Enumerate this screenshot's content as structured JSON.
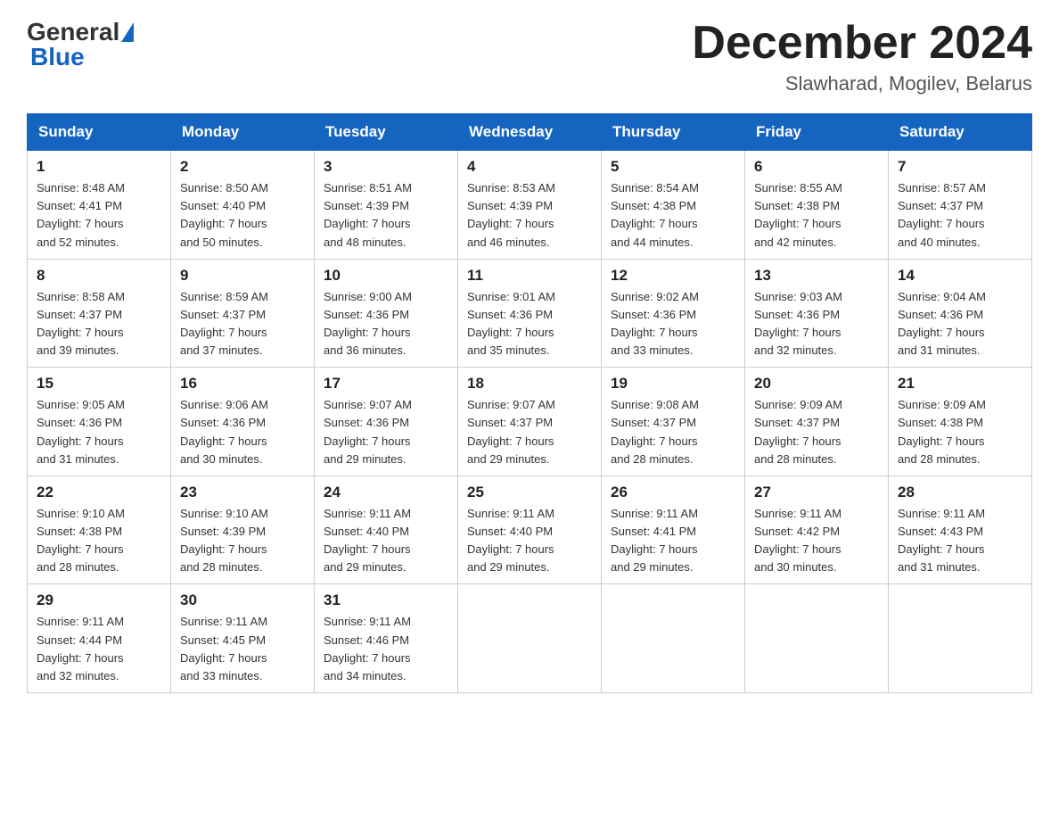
{
  "logo": {
    "general": "General",
    "blue": "Blue"
  },
  "header": {
    "month_year": "December 2024",
    "location": "Slawharad, Mogilev, Belarus"
  },
  "days_of_week": [
    "Sunday",
    "Monday",
    "Tuesday",
    "Wednesday",
    "Thursday",
    "Friday",
    "Saturday"
  ],
  "weeks": [
    [
      {
        "day": "1",
        "sunrise": "8:48 AM",
        "sunset": "4:41 PM",
        "daylight": "7 hours and 52 minutes."
      },
      {
        "day": "2",
        "sunrise": "8:50 AM",
        "sunset": "4:40 PM",
        "daylight": "7 hours and 50 minutes."
      },
      {
        "day": "3",
        "sunrise": "8:51 AM",
        "sunset": "4:39 PM",
        "daylight": "7 hours and 48 minutes."
      },
      {
        "day": "4",
        "sunrise": "8:53 AM",
        "sunset": "4:39 PM",
        "daylight": "7 hours and 46 minutes."
      },
      {
        "day": "5",
        "sunrise": "8:54 AM",
        "sunset": "4:38 PM",
        "daylight": "7 hours and 44 minutes."
      },
      {
        "day": "6",
        "sunrise": "8:55 AM",
        "sunset": "4:38 PM",
        "daylight": "7 hours and 42 minutes."
      },
      {
        "day": "7",
        "sunrise": "8:57 AM",
        "sunset": "4:37 PM",
        "daylight": "7 hours and 40 minutes."
      }
    ],
    [
      {
        "day": "8",
        "sunrise": "8:58 AM",
        "sunset": "4:37 PM",
        "daylight": "7 hours and 39 minutes."
      },
      {
        "day": "9",
        "sunrise": "8:59 AM",
        "sunset": "4:37 PM",
        "daylight": "7 hours and 37 minutes."
      },
      {
        "day": "10",
        "sunrise": "9:00 AM",
        "sunset": "4:36 PM",
        "daylight": "7 hours and 36 minutes."
      },
      {
        "day": "11",
        "sunrise": "9:01 AM",
        "sunset": "4:36 PM",
        "daylight": "7 hours and 35 minutes."
      },
      {
        "day": "12",
        "sunrise": "9:02 AM",
        "sunset": "4:36 PM",
        "daylight": "7 hours and 33 minutes."
      },
      {
        "day": "13",
        "sunrise": "9:03 AM",
        "sunset": "4:36 PM",
        "daylight": "7 hours and 32 minutes."
      },
      {
        "day": "14",
        "sunrise": "9:04 AM",
        "sunset": "4:36 PM",
        "daylight": "7 hours and 31 minutes."
      }
    ],
    [
      {
        "day": "15",
        "sunrise": "9:05 AM",
        "sunset": "4:36 PM",
        "daylight": "7 hours and 31 minutes."
      },
      {
        "day": "16",
        "sunrise": "9:06 AM",
        "sunset": "4:36 PM",
        "daylight": "7 hours and 30 minutes."
      },
      {
        "day": "17",
        "sunrise": "9:07 AM",
        "sunset": "4:36 PM",
        "daylight": "7 hours and 29 minutes."
      },
      {
        "day": "18",
        "sunrise": "9:07 AM",
        "sunset": "4:37 PM",
        "daylight": "7 hours and 29 minutes."
      },
      {
        "day": "19",
        "sunrise": "9:08 AM",
        "sunset": "4:37 PM",
        "daylight": "7 hours and 28 minutes."
      },
      {
        "day": "20",
        "sunrise": "9:09 AM",
        "sunset": "4:37 PM",
        "daylight": "7 hours and 28 minutes."
      },
      {
        "day": "21",
        "sunrise": "9:09 AM",
        "sunset": "4:38 PM",
        "daylight": "7 hours and 28 minutes."
      }
    ],
    [
      {
        "day": "22",
        "sunrise": "9:10 AM",
        "sunset": "4:38 PM",
        "daylight": "7 hours and 28 minutes."
      },
      {
        "day": "23",
        "sunrise": "9:10 AM",
        "sunset": "4:39 PM",
        "daylight": "7 hours and 28 minutes."
      },
      {
        "day": "24",
        "sunrise": "9:11 AM",
        "sunset": "4:40 PM",
        "daylight": "7 hours and 29 minutes."
      },
      {
        "day": "25",
        "sunrise": "9:11 AM",
        "sunset": "4:40 PM",
        "daylight": "7 hours and 29 minutes."
      },
      {
        "day": "26",
        "sunrise": "9:11 AM",
        "sunset": "4:41 PM",
        "daylight": "7 hours and 29 minutes."
      },
      {
        "day": "27",
        "sunrise": "9:11 AM",
        "sunset": "4:42 PM",
        "daylight": "7 hours and 30 minutes."
      },
      {
        "day": "28",
        "sunrise": "9:11 AM",
        "sunset": "4:43 PM",
        "daylight": "7 hours and 31 minutes."
      }
    ],
    [
      {
        "day": "29",
        "sunrise": "9:11 AM",
        "sunset": "4:44 PM",
        "daylight": "7 hours and 32 minutes."
      },
      {
        "day": "30",
        "sunrise": "9:11 AM",
        "sunset": "4:45 PM",
        "daylight": "7 hours and 33 minutes."
      },
      {
        "day": "31",
        "sunrise": "9:11 AM",
        "sunset": "4:46 PM",
        "daylight": "7 hours and 34 minutes."
      },
      null,
      null,
      null,
      null
    ]
  ],
  "labels": {
    "sunrise": "Sunrise:",
    "sunset": "Sunset:",
    "daylight": "Daylight:"
  }
}
